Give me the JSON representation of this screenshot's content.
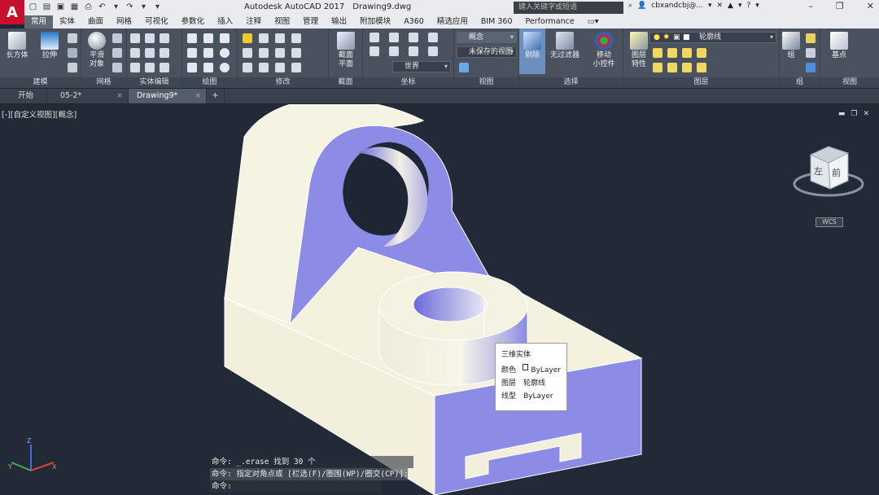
{
  "app": {
    "logo": "A",
    "title": "Autodesk AutoCAD 2017",
    "filename": "Drawing9.dwg",
    "search_placeholder": "键入关键字或短语",
    "username": "cbxandcbj@..."
  },
  "ribbon_tabs": [
    "常用",
    "实体",
    "曲面",
    "网格",
    "可视化",
    "参数化",
    "插入",
    "注释",
    "视图",
    "管理",
    "输出",
    "附加模块",
    "A360",
    "精选应用",
    "BIM 360",
    "Performance"
  ],
  "ribbon": {
    "build": {
      "box": "长方体",
      "extrude": "拉伸",
      "label": "建模"
    },
    "mesh": {
      "smooth_1": "平滑",
      "smooth_2": "对象",
      "label": "网格"
    },
    "solid_edit": {
      "label": "实体编辑"
    },
    "draw": {
      "label": "绘图"
    },
    "modify": {
      "label": "修改"
    },
    "section": {
      "plane_1": "截面",
      "plane_2": "平面",
      "label": "截面"
    },
    "coords": {
      "world": "世界",
      "label": "坐标"
    },
    "view": {
      "visual_style": "概念",
      "unsaved_view": "未保存的视图",
      "label": "视图"
    },
    "selection": {
      "cull": "剔除",
      "no_filter": "无过滤器",
      "gizmo_1": "移动",
      "gizmo_2": "小控件",
      "label": "选择"
    },
    "layers": {
      "props_1": "图层",
      "props_2": "特性",
      "current_layer": "轮廓线",
      "label": "图层"
    },
    "groups": {
      "group": "组",
      "label": "组"
    },
    "view2": {
      "base": "基点",
      "label": "视图"
    }
  },
  "file_tabs": [
    {
      "label": "开始"
    },
    {
      "label": "05-2*"
    },
    {
      "label": "Drawing9*"
    }
  ],
  "viewport": {
    "label": "[-][自定义视图][概念]",
    "viewcube_left": "左",
    "viewcube_front": "前",
    "wcs": "WCS"
  },
  "tooltip": {
    "title": "三维实体",
    "rows": [
      {
        "k": "颜色",
        "v": "ByLayer"
      },
      {
        "k": "图层",
        "v": "轮廓线"
      },
      {
        "k": "线型",
        "v": "ByLayer"
      }
    ]
  },
  "command_lines": [
    "命令: _.erase 找到 30 个",
    "命令: 指定对角点或 [栏选(F)/圈围(WP)/圈交(CP)]:",
    "命令:"
  ],
  "colors": {
    "solid_face": "#f3f1de",
    "solid_shade": "#8c8ce6",
    "background": "#212a36",
    "ribbon": "#4a5260",
    "brand": "#c8102e"
  }
}
